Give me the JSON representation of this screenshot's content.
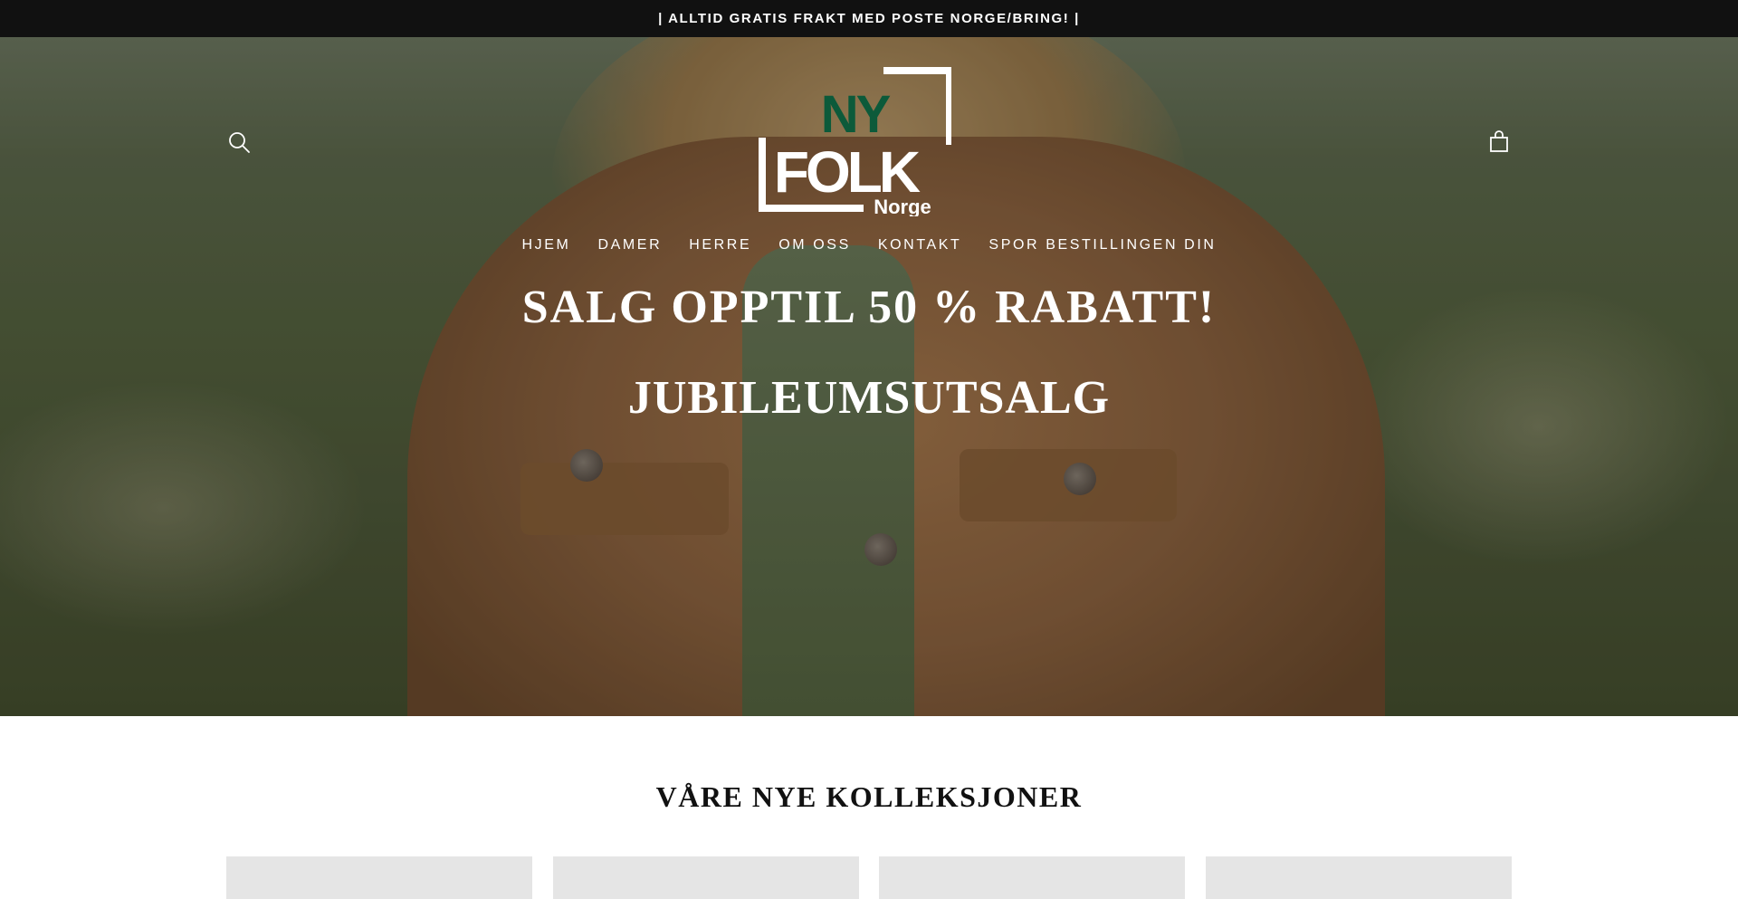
{
  "announcement": {
    "text": "| ALLTID GRATIS FRAKT MED POSTE NORGE/BRING! |"
  },
  "brand": {
    "logo_text_top": "NY",
    "logo_text_main": "FOLK",
    "logo_text_sub": "Norge",
    "accent_color": "#0c5a3a"
  },
  "header": {
    "search_icon": "search-icon",
    "cart_icon": "shopping-bag-icon"
  },
  "nav": {
    "items": [
      {
        "label": "HJEM"
      },
      {
        "label": "DAMER"
      },
      {
        "label": "HERRE"
      },
      {
        "label": "OM OSS"
      },
      {
        "label": "KONTAKT"
      },
      {
        "label": "SPOR BESTILLINGEN DIN"
      }
    ]
  },
  "hero": {
    "title": "SALG OPPTIL 50 % RABATT!",
    "subtitle": "JUBILEUMSUTSALG"
  },
  "collections": {
    "heading": "VÅRE NYE KOLLEKSJONER",
    "card_count_visible": 4
  }
}
